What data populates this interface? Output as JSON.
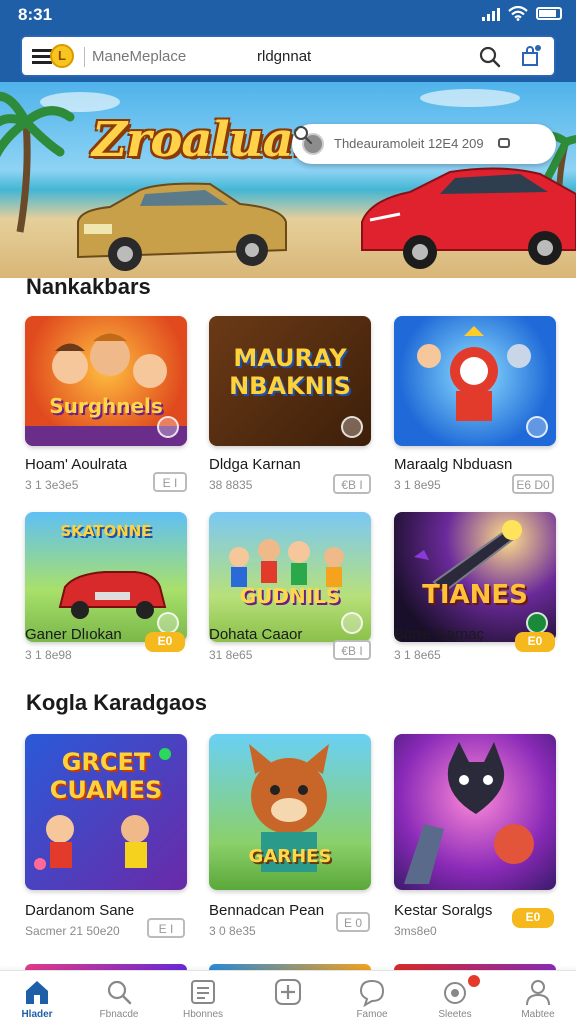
{
  "status_bar": {
    "time": "8:31"
  },
  "header": {
    "coin_symbol": "L",
    "search_scope": "ManeMeplace",
    "search_query": "rldgnnat"
  },
  "hero": {
    "title": "Zroaluan",
    "search_placeholder": "Thdeauramoleit 12E4 209"
  },
  "sections": [
    {
      "title": "Nankakbars",
      "games": [
        {
          "art_text": "Surghnels",
          "name": "Hoam' Aoulrata",
          "meta": "3 1 3e3e5",
          "tag": "E I",
          "tag_style": "grey"
        },
        {
          "art_text": "MAURAY NBAKNIS",
          "name": "Dldga Karnan",
          "meta": "38 8835",
          "tag": "€B I",
          "tag_style": "grey"
        },
        {
          "art_text": "",
          "name": "Maraalg Nbduasn",
          "meta": "3 1 8e95",
          "tag": "E6 D0",
          "tag_style": "grey"
        },
        {
          "art_text": "SKATONNE",
          "name": "Ganer Dlıokan",
          "meta": "3 1 8e98",
          "tag": "E0",
          "tag_style": "yellow"
        },
        {
          "art_text": "GUDNILS",
          "name": "Dohata Caaor",
          "meta": "31 8e65",
          "tag": "€B I",
          "tag_style": "grey"
        },
        {
          "art_text": "TIANES",
          "name": "Borre Garnaç",
          "meta": "3 1 8e65",
          "tag": "E0",
          "tag_style": "yellow"
        }
      ]
    },
    {
      "title": "Kogla Karadgaos",
      "games": [
        {
          "art_text": "GRCET CUAMES",
          "name": "Dardanom Sane",
          "meta": "Sacmer 21 50e20",
          "tag": "E I",
          "tag_style": "grey"
        },
        {
          "art_text": "GARHES",
          "name": "Bennadcan Pean",
          "meta": "3 0 8e35",
          "tag": "E 0",
          "tag_style": "grey"
        },
        {
          "art_text": "",
          "name": "Kestar Soralgs",
          "meta": "3ms8e0",
          "tag": "E0",
          "tag_style": "yellow"
        }
      ]
    }
  ],
  "bottom_nav": [
    {
      "label": "Hlader",
      "icon": "home-icon",
      "active": true
    },
    {
      "label": "Fbnacde",
      "icon": "search-icon",
      "active": false
    },
    {
      "label": "Hbonnes",
      "icon": "list-icon",
      "active": false
    },
    {
      "label": "",
      "icon": "add-icon",
      "active": false
    },
    {
      "label": "Famoe",
      "icon": "chat-icon",
      "active": false
    },
    {
      "label": "Sleetes",
      "icon": "games-icon",
      "active": false
    },
    {
      "label": "Mabtee",
      "icon": "profile-icon",
      "active": false
    }
  ],
  "colors": {
    "brand_blue": "#1f5fa8",
    "accent_yellow": "#f5b91e",
    "alert_red": "#e23b2c"
  }
}
